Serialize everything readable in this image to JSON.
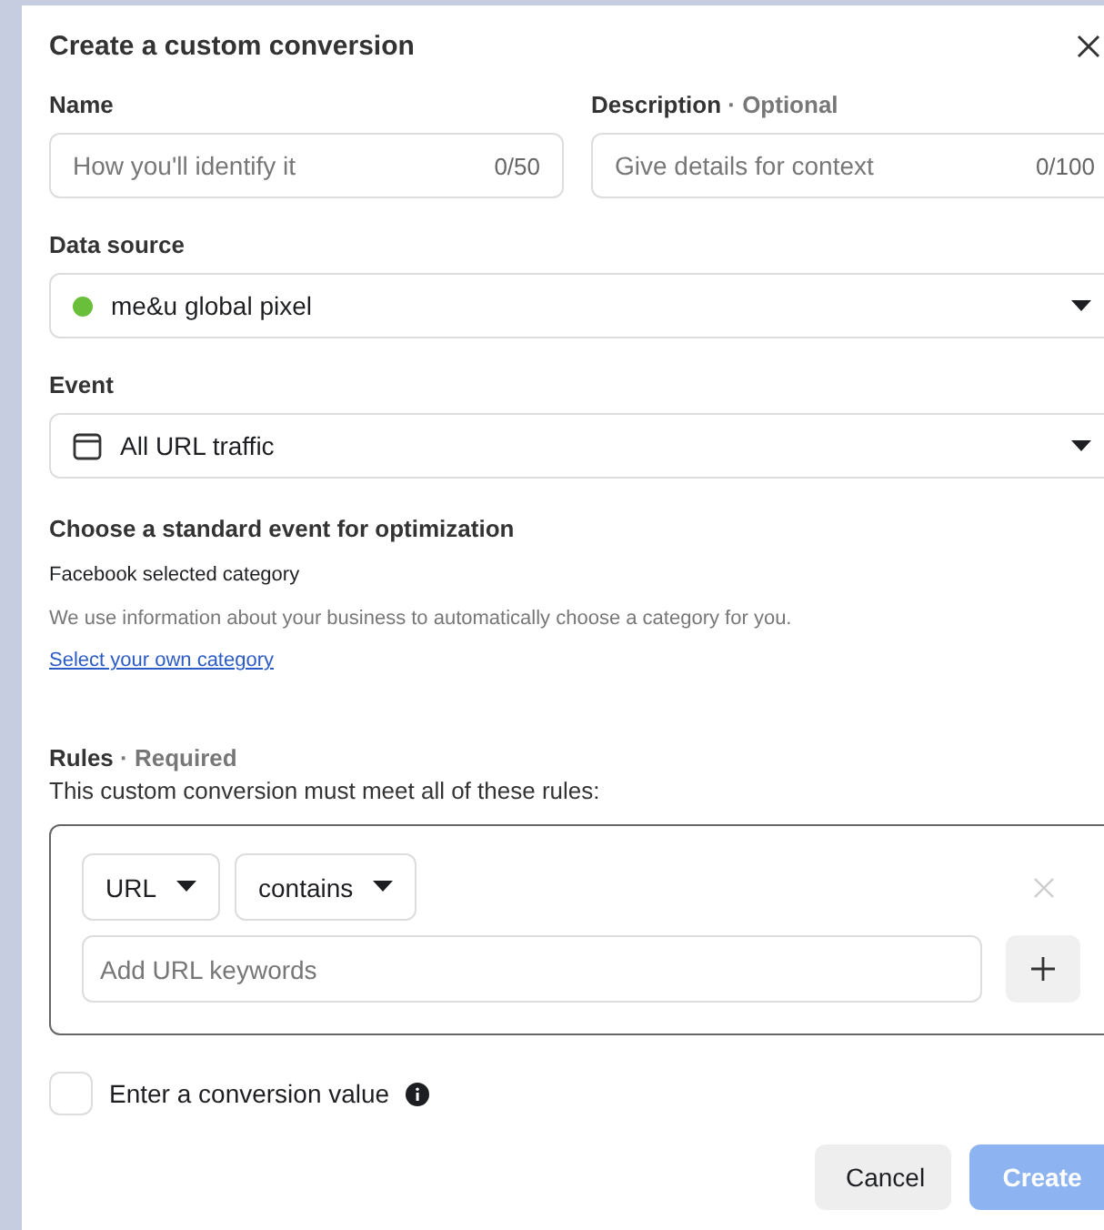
{
  "dialog": {
    "title": "Create a custom conversion"
  },
  "name": {
    "label": "Name",
    "placeholder": "How you'll identify it",
    "counter": "0/50"
  },
  "description": {
    "label": "Description",
    "note": "· Optional",
    "placeholder": "Give details for context",
    "counter": "0/100"
  },
  "data_source": {
    "label": "Data source",
    "value": "me&u global pixel",
    "color": "#6abf3a"
  },
  "event": {
    "label": "Event",
    "value": "All URL traffic"
  },
  "optimization": {
    "heading": "Choose a standard event for optimization",
    "category": "Facebook selected category",
    "help": "We use information about your business to automatically choose a category for you.",
    "link": "Select your own category"
  },
  "rules": {
    "label": "Rules",
    "note": "· Required",
    "subtitle": "This custom conversion must meet all of these rules:",
    "field": "URL",
    "operator": "contains",
    "placeholder": "Add URL keywords"
  },
  "conversion_value": {
    "label": "Enter a conversion value",
    "checked": false
  },
  "buttons": [
    {
      "label": "Cancel",
      "disabled": false
    },
    {
      "label": "Create",
      "disabled": true
    }
  ]
}
